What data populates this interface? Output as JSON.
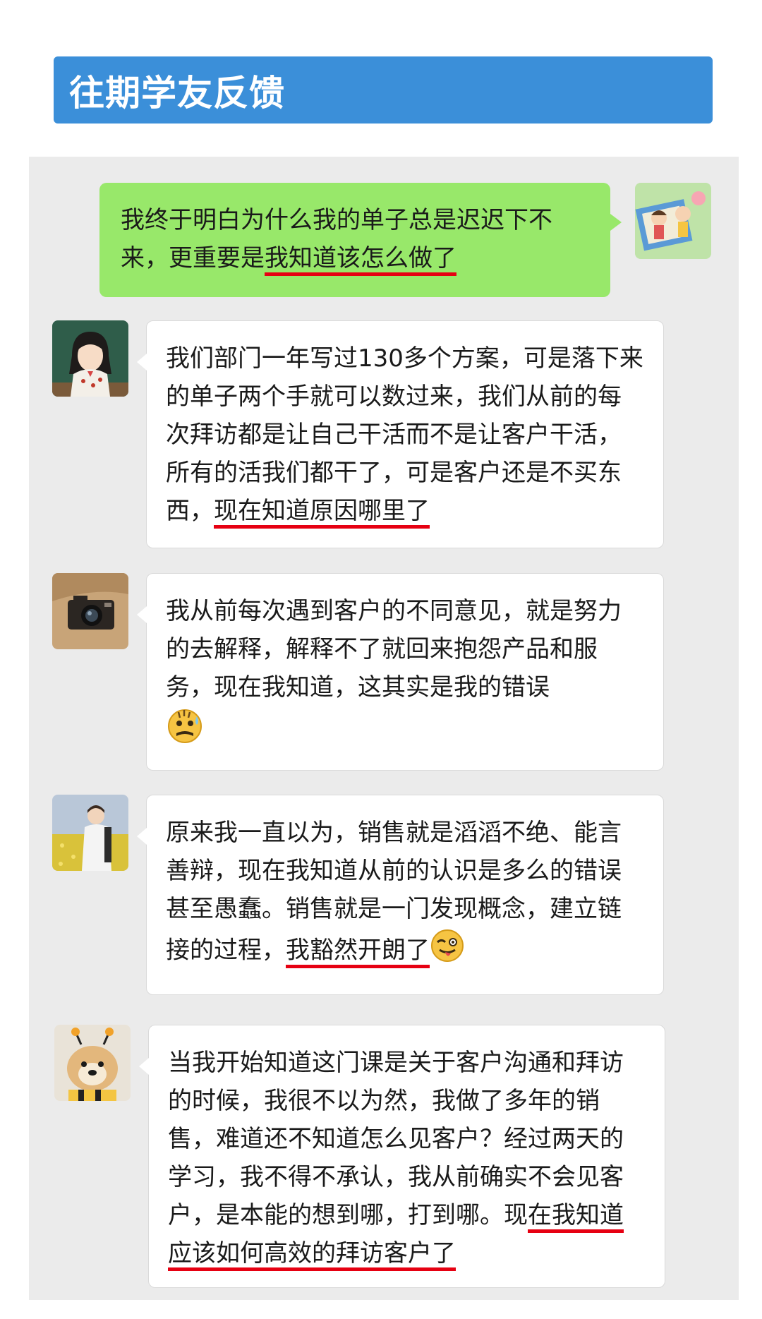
{
  "header": {
    "title": "往期学友反馈"
  },
  "colors": {
    "banner": "#3b8fd9",
    "outgoing_bubble": "#98e86a",
    "highlight_underline": "#e60012",
    "panel": "#ebebeb"
  },
  "messages": [
    {
      "direction": "outgoing",
      "avatar": "cartoon-kids-picnic-avatar",
      "text": "我终于明白为什么我的单子总是迟迟下不来，更重要是",
      "highlight": "我知道该怎么做了"
    },
    {
      "direction": "incoming",
      "avatar": "girl-at-blackboard-avatar",
      "text": "我们部门一年写过130多个方案，可是落下来的单子两个手就可以数过来，我们从前的每次拜访都是让自己干活而不是让客户干活，所有的活我们都干了，可是客户还是不买东西，",
      "highlight": "现在知道原因哪里了"
    },
    {
      "direction": "incoming",
      "avatar": "vintage-camera-avatar",
      "text": "我从前每次遇到客户的不同意见，就是努力的去解释，解释不了就回来抱怨产品和服务，现在我知道，这其实是我的错误",
      "emoji": "sweating-face-emoji"
    },
    {
      "direction": "incoming",
      "avatar": "man-in-flower-field-avatar",
      "text": "原来我一直以为，销售就是滔滔不绝、能言善辩，现在我知道从前的认识是多么的错误甚至愚蠢。销售就是一门发现概念，建立链接的过程，",
      "highlight": "我豁然开朗了",
      "emoji": "winking-tongue-emoji"
    },
    {
      "direction": "incoming",
      "avatar": "dog-with-bee-antennae-avatar",
      "text": "当我开始知道这门课是关于客户沟通和拜访的时候，我很不以为然，我做了多年的销售，难道还不知道怎么见客户？经过两天的学习，我不得不承认，我从前确实不会见客户，是本能的想到哪，打到哪。现",
      "highlight": "在我知道应该如何高效的拜访客户了"
    }
  ]
}
